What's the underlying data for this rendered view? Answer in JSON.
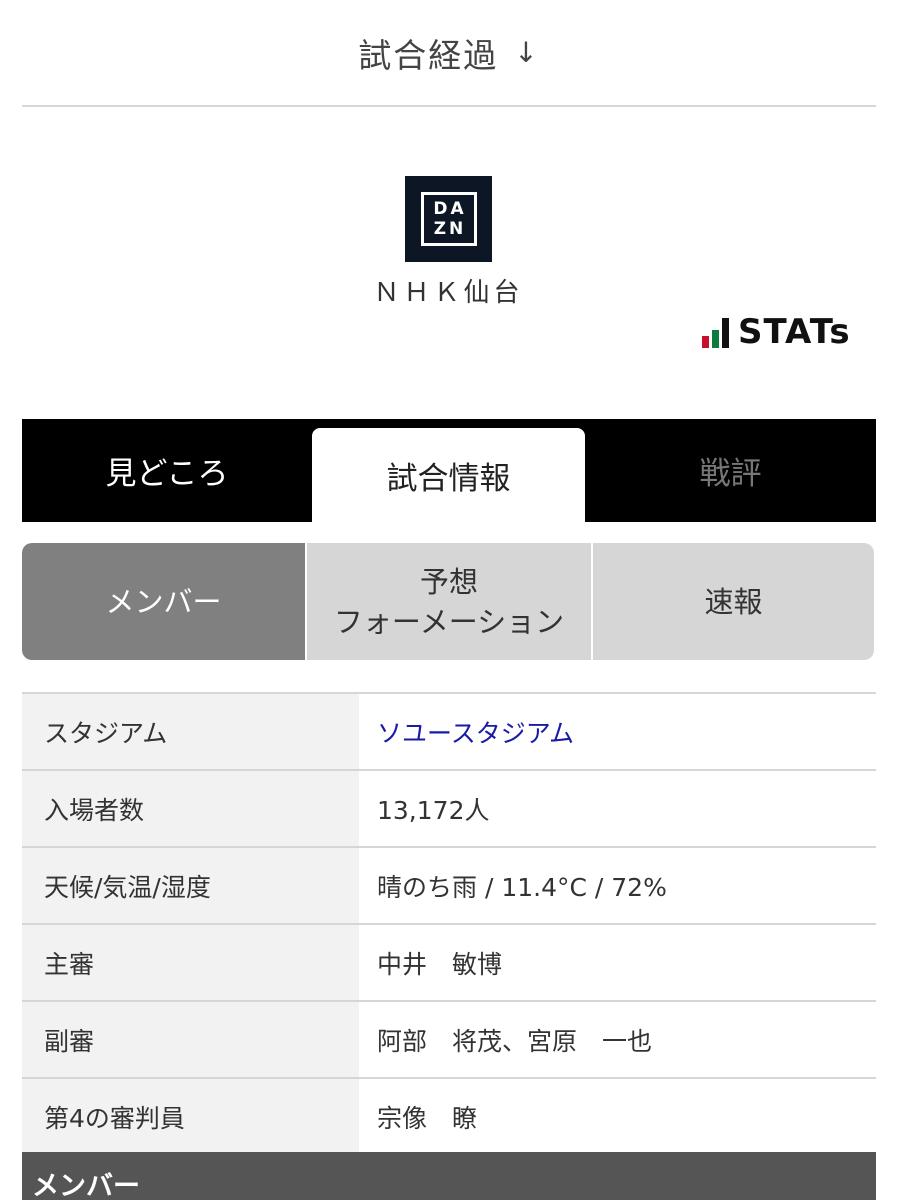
{
  "header": {
    "title": "試合経過",
    "arrow": "↓"
  },
  "broadcast": {
    "logo_top": "DA",
    "logo_bottom": "ZN",
    "broadcaster": "ＮＨＫ仙台"
  },
  "stats_logo": {
    "text": "STATs",
    "colors": [
      "#c8102e",
      "#0a7c3e",
      "#111111"
    ]
  },
  "main_tabs": [
    {
      "label": "見どころ",
      "state": "inactive"
    },
    {
      "label": "試合情報",
      "state": "active"
    },
    {
      "label": "戦評",
      "state": "disabled"
    }
  ],
  "sub_tabs": [
    {
      "label": "メンバー",
      "state": "selected"
    },
    {
      "label_line1": "予想",
      "label_line2": "フォーメーション",
      "state": "default"
    },
    {
      "label": "速報",
      "state": "default"
    }
  ],
  "info_rows": [
    {
      "label": "スタジアム",
      "value": "ソユースタジアム",
      "is_link": true
    },
    {
      "label": "入場者数",
      "value": "13,172人"
    },
    {
      "label": "天候/気温/湿度",
      "value": "晴のち雨 / 11.4°C / 72%"
    },
    {
      "label": "主審",
      "value": "中井　敏博"
    },
    {
      "label": "副審",
      "value": "阿部　将茂、宮原　一也"
    },
    {
      "label": "第4の審判員",
      "value": "宗像　瞭"
    }
  ],
  "section_header": "メンバー",
  "colors": {
    "tab_bar": "#000000",
    "selected_subtab": "#808080",
    "link": "#1a1aa8"
  }
}
